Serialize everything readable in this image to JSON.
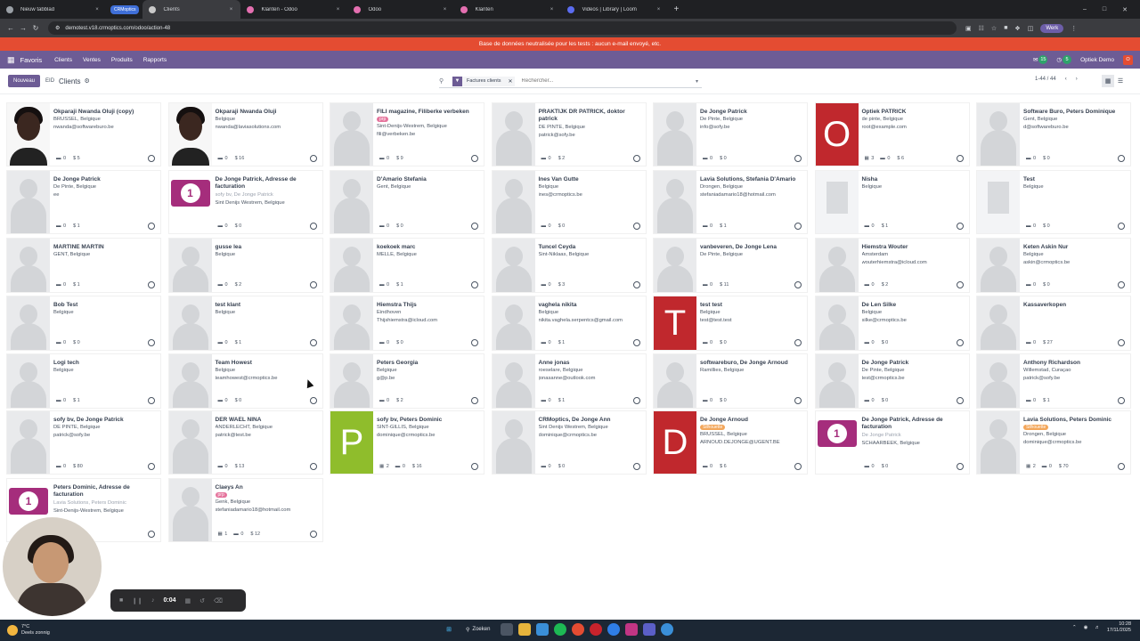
{
  "browser": {
    "tabs": [
      {
        "label": "Nieuw tabblad",
        "icon": "chrome-icon",
        "color": "#9aa0a6"
      },
      {
        "label": "CRMoptics",
        "icon": "tab-group-pill",
        "color": "#3f6fd8",
        "group": true
      },
      {
        "label": "Clients",
        "icon": "odoo-icon",
        "color": "#c9c9c9",
        "active": true
      },
      {
        "label": "Klanten - Odoo",
        "icon": "odoo-icon",
        "color": "#e46fb0"
      },
      {
        "label": "Odoo",
        "icon": "odoo-icon",
        "color": "#e46fb0"
      },
      {
        "label": "Klanten",
        "icon": "odoo-icon",
        "color": "#e46fb0"
      },
      {
        "label": "Videos | Library | Loom",
        "icon": "loom-icon",
        "color": "#5b6cf0"
      }
    ],
    "new_tab": "+",
    "url": "demotest.v18.crmoptics.com/odoo/action-48",
    "profile": "Werk"
  },
  "banner": "Base de données neutralisée pour les tests : aucun e-mail envoyé, etc.",
  "topnav": {
    "brand": "Favoris",
    "menus": [
      "Clients",
      "Ventes",
      "Produits",
      "Rapports"
    ],
    "badge1": "15",
    "badge2": "5",
    "company": "Optiek Demo",
    "avatar": "O"
  },
  "control": {
    "new_button": "Nouveau",
    "crumb_id": "EID",
    "crumb": "Clients",
    "facet": "Factures clients",
    "search_placeholder": "Rechercher...",
    "pager": "1-44 / 44"
  },
  "colors": {
    "brand": "#6d5c95",
    "banner": "#e44c32",
    "taglPink": "#e5739c",
    "tagOrange": "#f3a65a"
  },
  "cards": [
    {
      "name": "Okparaji Nwanda Oluji (copy)",
      "lines": [
        "BRUSSEL, Belgique",
        "nwanda@softwareburo.be"
      ],
      "stats": [
        "0",
        "$ 5"
      ],
      "ph": "person"
    },
    {
      "name": "Okparaji Nwanda Oluji",
      "lines": [
        "Belgique",
        "nwanda@laviasolutions.com"
      ],
      "stats": [
        "0",
        "$ 16"
      ],
      "ph": "person"
    },
    {
      "name": "FILI magazine, Filiberke verbeken",
      "tag": "prp",
      "tagc": "pink",
      "lines": [
        "Sint-Denijs-Westrem, Belgique",
        "fili@verbeken.be"
      ],
      "stats": [
        "0",
        "$ 9"
      ],
      "ph": "sil"
    },
    {
      "name": "PRAKTIJK DR PATRICK, doktor patrick",
      "lines": [
        "DE PINTE, Belgique",
        "patrick@sofy.be"
      ],
      "stats": [
        "0",
        "$ 2"
      ],
      "ph": "sil"
    },
    {
      "name": "De Jonge Patrick",
      "lines": [
        "De Pinte, Belgique",
        "info@sofy.be"
      ],
      "stats": [
        "0",
        "$ 0"
      ],
      "ph": "sil"
    },
    {
      "name": "Optiek PATRICK",
      "lines": [
        "de pinte, Belgique",
        "root@example.com"
      ],
      "stats": [
        "3",
        "0",
        "$ 6"
      ],
      "ph": "letter",
      "letter": "O",
      "lc": "#c0282d"
    },
    {
      "name": "Software Buro, Peters Dominique",
      "lines": [
        "Gent, Belgique",
        "d@softwareburo.be"
      ],
      "stats": [
        "0",
        "$ 0"
      ],
      "ph": "sil"
    },
    {
      "name": "De Jonge Patrick",
      "lines": [
        "De Pinte, Belgique",
        "ee"
      ],
      "stats": [
        "0",
        "$ 1"
      ],
      "ph": "sil"
    },
    {
      "name": "De Jonge Patrick, Adresse de facturation",
      "lines": [
        "sofy bv, De Jonge Patrick|muted",
        "Sint Denijs Westrem, Belgique"
      ],
      "stats": [
        "0",
        "$ 0"
      ],
      "ph": "inv"
    },
    {
      "name": "D'Amario Stefania",
      "lines": [
        "Gent, Belgique"
      ],
      "stats": [
        "0",
        "$ 0"
      ],
      "ph": "sil"
    },
    {
      "name": "Ines Van Gutte",
      "lines": [
        "Belgique",
        "ines@crmoptics.be"
      ],
      "stats": [
        "0",
        "$ 0"
      ],
      "ph": "sil"
    },
    {
      "name": "Lavia Solutions, Stefania D'Amario",
      "lines": [
        "Drongen, Belgique",
        "stefaniadamario18@hotmail.com"
      ],
      "stats": [
        "0",
        "$ 1"
      ],
      "ph": "sil"
    },
    {
      "name": "Nisha",
      "lines": [
        "Belgique"
      ],
      "stats": [
        "0",
        "$ 1"
      ],
      "ph": "bld"
    },
    {
      "name": "Test",
      "lines": [
        "Belgique"
      ],
      "stats": [
        "0",
        "$ 0"
      ],
      "ph": "bld"
    },
    {
      "name": "MARTINE MARTIN",
      "lines": [
        "GENT, Belgique"
      ],
      "stats": [
        "0",
        "$ 1"
      ],
      "ph": "sil"
    },
    {
      "name": "gusse lea",
      "lines": [
        "Belgique"
      ],
      "stats": [
        "0",
        "$ 2"
      ],
      "ph": "sil"
    },
    {
      "name": "koekoek marc",
      "lines": [
        "MELLE, Belgique"
      ],
      "stats": [
        "0",
        "$ 1"
      ],
      "ph": "sil"
    },
    {
      "name": "Tuncel Ceyda",
      "lines": [
        "Sint-Niklaas, Belgique"
      ],
      "stats": [
        "0",
        "$ 3"
      ],
      "ph": "sil"
    },
    {
      "name": "vanbeveren, De Jonge Lena",
      "lines": [
        "De Pinte, Belgique"
      ],
      "stats": [
        "0",
        "$ 11"
      ],
      "ph": "sil"
    },
    {
      "name": "Hiemstra Wouter",
      "lines": [
        "Amsterdam",
        "wouterhiemstra@icloud.com"
      ],
      "stats": [
        "0",
        "$ 2"
      ],
      "ph": "sil"
    },
    {
      "name": "Keten Askin Nur",
      "lines": [
        "Belgique",
        "askin@crmoptics.be"
      ],
      "stats": [
        "0",
        "$ 0"
      ],
      "ph": "sil"
    },
    {
      "name": "Bob Test",
      "lines": [
        "Belgique"
      ],
      "stats": [
        "0",
        "$ 0"
      ],
      "ph": "sil"
    },
    {
      "name": "test klant",
      "lines": [
        "Belgique"
      ],
      "stats": [
        "0",
        "$ 1"
      ],
      "ph": "sil"
    },
    {
      "name": "Hiemstra Thijs",
      "lines": [
        "Eindhoven",
        "Thijshiemstra@icloud.com"
      ],
      "stats": [
        "0",
        "$ 0"
      ],
      "ph": "sil"
    },
    {
      "name": "vaghela nikita",
      "lines": [
        "Belgique",
        "nikita.vaghela.serpentcs@gmail.com"
      ],
      "stats": [
        "0",
        "$ 1"
      ],
      "ph": "sil"
    },
    {
      "name": "test test",
      "lines": [
        "Belgique",
        "test@test.test"
      ],
      "stats": [
        "0",
        "$ 0"
      ],
      "ph": "letter",
      "letter": "T",
      "lc": "#c0282d"
    },
    {
      "name": "De Len Silke",
      "lines": [
        "Belgique",
        "silke@crmoptics.be"
      ],
      "stats": [
        "0",
        "$ 0"
      ],
      "ph": "sil"
    },
    {
      "name": "Kassaverkopen",
      "lines": [],
      "stats": [
        "0",
        "$ 27"
      ],
      "ph": "sil"
    },
    {
      "name": "Logi tech",
      "lines": [
        "Belgique"
      ],
      "stats": [
        "0",
        "$ 1"
      ],
      "ph": "sil"
    },
    {
      "name": "Team Howest",
      "lines": [
        "Belgique",
        "teamhowest@crmoptics.be"
      ],
      "stats": [
        "0",
        "$ 0"
      ],
      "ph": "sil"
    },
    {
      "name": "Peters Georgia",
      "lines": [
        "Belgique",
        "g@p.be"
      ],
      "stats": [
        "0",
        "$ 2"
      ],
      "ph": "sil"
    },
    {
      "name": "Anne jonas",
      "lines": [
        "roeselare, Belgique",
        "jonasanne@outlook.com"
      ],
      "stats": [
        "0",
        "$ 1"
      ],
      "ph": "sil"
    },
    {
      "name": "softwareburo, De Jonge Arnoud",
      "lines": [
        "Ramillies, Belgique"
      ],
      "stats": [
        "0",
        "$ 0"
      ],
      "ph": "sil"
    },
    {
      "name": "De Jonge Patrick",
      "lines": [
        "De Pinte, Belgique",
        "test@crmoptics.be"
      ],
      "stats": [
        "0",
        "$ 0"
      ],
      "ph": "sil"
    },
    {
      "name": "Anthony Richardson",
      "lines": [
        "Willemstad, Curaçao",
        "patrick@sofy.be"
      ],
      "stats": [
        "0",
        "$ 1"
      ],
      "ph": "sil"
    },
    {
      "name": "sofy bv, De Jonge Patrick",
      "lines": [
        "DE PINTE, Belgique",
        "patrick@sofy.be"
      ],
      "stats": [
        "0",
        "$ 80"
      ],
      "ph": "sil"
    },
    {
      "name": "DER WAEL NINA",
      "lines": [
        "ANDERLECHT, Belgique",
        "patrick@test.be"
      ],
      "stats": [
        "0",
        "$ 13"
      ],
      "ph": "sil"
    },
    {
      "name": "sofy bv, Peters Dominic",
      "lines": [
        "SINT-GILLIS, Belgique",
        "dominique@crmoptics.be"
      ],
      "stats": [
        "2",
        "0",
        "$ 16"
      ],
      "ph": "letter",
      "letter": "P",
      "lc": "#8fbd2c"
    },
    {
      "name": "CRMoptics, De Jonge Ann",
      "lines": [
        "Sint Denijs Westrem, Belgique",
        "dominique@crmoptics.be"
      ],
      "stats": [
        "0",
        "$ 0"
      ],
      "ph": "sil"
    },
    {
      "name": "De Jonge Arnoud",
      "tag": "Silhouette",
      "tagc": "orange",
      "lines": [
        "BRUSSEL, Belgique",
        "ARNOUD.DEJONGE@UGENT.BE"
      ],
      "stats": [
        "0",
        "$ 6"
      ],
      "ph": "letter",
      "letter": "D",
      "lc": "#c0282d"
    },
    {
      "name": "De Jonge Patrick, Adresse de facturation",
      "lines": [
        "De Jonge Patrick|muted",
        "SCHAARBEEK, Belgique"
      ],
      "stats": [
        "0",
        "$ 0"
      ],
      "ph": "inv"
    },
    {
      "name": "Lavia Solutions, Peters Dominic",
      "tag": "Silhouette",
      "tagc": "orange",
      "lines": [
        "Drongen, Belgique",
        "dominique@crmoptics.be"
      ],
      "stats": [
        "2",
        "0",
        "$ 70"
      ],
      "ph": "sil"
    },
    {
      "name": "Peters Dominic, Adresse de facturation",
      "lines": [
        "Lavia Solutions, Peters Dominic|muted",
        "Sint-Denijs-Westrem, Belgique"
      ],
      "stats": [
        "0",
        "$ 0"
      ],
      "ph": "inv"
    },
    {
      "name": "Claeys An",
      "tag": "prp",
      "tagc": "pink",
      "lines": [
        "Genk, Belgique",
        "stefaniadamario18@hotmail.com"
      ],
      "stats": [
        "1",
        "0",
        "$ 12"
      ],
      "ph": "sil"
    }
  ],
  "recorder": {
    "time": "0:04"
  },
  "taskbar": {
    "temp": "7°C",
    "weather": "Deels zonnig",
    "search": "Zoeken",
    "time": "10:28",
    "date": "17/11/2025"
  }
}
